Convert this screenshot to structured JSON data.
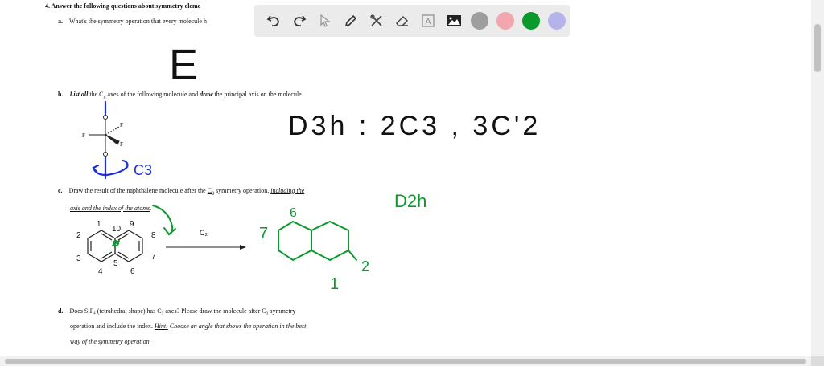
{
  "doc": {
    "question_title": "4.   Answer the following questions about symmetry eleme",
    "part_a": {
      "label": "a.",
      "text": "What's the symmetry operation that every molecule h"
    },
    "part_b": {
      "label": "b.",
      "prefix": "List all",
      "mid1": " the C",
      "sub": "n",
      "mid2": " axes of the following molecule and ",
      "emph": "draw",
      "suffix": " the principal axis on the molecule."
    },
    "part_c": {
      "label": "c.",
      "line1_a": "Draw the result of the naphthalene molecule after the ",
      "line1_c2": "C",
      "line1_c2sub": "2",
      "line1_b": " symmetry operation, ",
      "line1_u": "including the",
      "line2_u": "axis and the index of the atoms",
      "line2_end": "."
    },
    "part_d": {
      "label": "d.",
      "line1": "Does SiF₄ (tetrahedral shape) has C₃ axes? Please draw the molecule after C₃ symmetry",
      "line2": "operation and include the index. ",
      "line2_hint": "Hint:",
      "line2_rest": " Choose an angle that shows the operation in the best",
      "line3": "way of the symmetry operation."
    },
    "mol_b": {
      "f_left": "F",
      "f_up": "F",
      "f_right": "F"
    },
    "naphthalene": {
      "idx1": "1",
      "idx2": "2",
      "idx3": "3",
      "idx4": "4",
      "idx5": "5",
      "idx6": "6",
      "idx7": "7",
      "idx8": "8",
      "idx9": "9",
      "idx10": "10",
      "arrow_label": "C₂"
    }
  },
  "handwriting": {
    "answer_a": "E",
    "answer_b": "D3h : 2C3 , 3C'2",
    "b_axis_mark": "C3",
    "c_group": "D2h",
    "c_idx_top": "6",
    "c_idx_left": "7",
    "c_idx_right": "2",
    "c_idx_bottom": "1"
  },
  "toolbar": {
    "tools": [
      "undo-icon",
      "redo-icon",
      "select-pointer-icon",
      "pen-icon",
      "tools-icon",
      "eraser-icon",
      "text-icon",
      "image-icon"
    ],
    "colors": [
      "#9e9e9e",
      "#f2a7ae",
      "#0a9a2c",
      "#b4b3ea"
    ],
    "text_tool_glyph": "A"
  }
}
